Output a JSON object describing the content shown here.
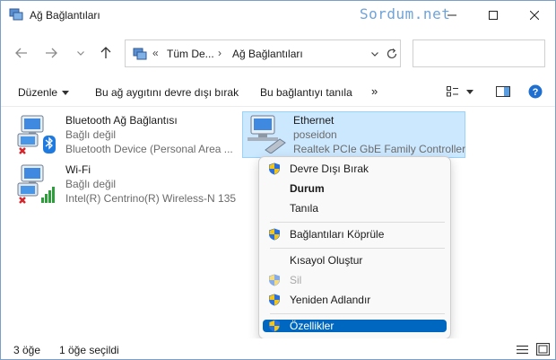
{
  "window": {
    "title": "Ağ Bağlantıları",
    "watermark": "Sordum.net"
  },
  "address": {
    "overflow": "«",
    "crumbs": [
      "Tüm De...",
      "Ağ Bağlantıları"
    ],
    "separator": "›"
  },
  "commands": {
    "organize": "Düzenle",
    "disable": "Bu ağ aygıtını devre dışı bırak",
    "diagnose": "Bu bağlantıyı tanıla",
    "more": "»"
  },
  "connections": [
    {
      "name": "Bluetooth Ağ Bağlantısı",
      "status": "Bağlı değil",
      "device": "Bluetooth Device (Personal Area ..."
    },
    {
      "name": "Ethernet",
      "status": "poseidon",
      "device": "Realtek PCIe GbE Family Controller"
    },
    {
      "name": "Wi-Fi",
      "status": "Bağlı değil",
      "device": "Intel(R) Centrino(R) Wireless-N 135"
    }
  ],
  "context_menu": [
    {
      "label": "Devre Dışı Bırak",
      "shield": true
    },
    {
      "label": "Durum",
      "bold": true
    },
    {
      "label": "Tanıla"
    },
    {
      "label": "Bağlantıları Köprüle",
      "shield": true
    },
    {
      "label": "Kısayol Oluştur"
    },
    {
      "label": "Sil",
      "shield": true,
      "disabled": true
    },
    {
      "label": "Yeniden Adlandır",
      "shield": true
    },
    {
      "label": "Özellikler",
      "shield": true,
      "highlighted": true
    }
  ],
  "status": {
    "count": "3 öğe",
    "selected": "1 öğe seçildi"
  },
  "colors": {
    "selection": "#cce8ff",
    "highlight": "#0067c0",
    "help": "#1e6fd0"
  }
}
